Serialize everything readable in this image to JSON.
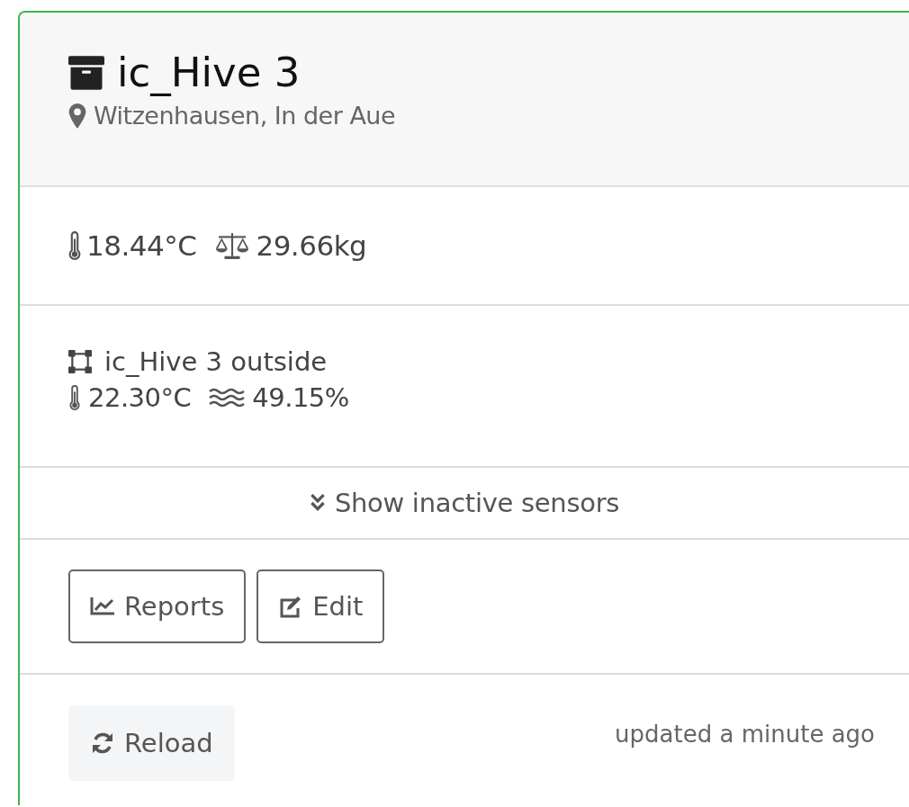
{
  "hive": {
    "title": "ic_Hive 3",
    "location": "Witzenhausen, In der Aue"
  },
  "readings": [
    {
      "kind": "temperature",
      "value": "18.44°C"
    },
    {
      "kind": "weight",
      "value": "29.66kg"
    }
  ],
  "sensor": {
    "name": "ic_Hive 3 outside",
    "readings": [
      {
        "kind": "temperature",
        "value": "22.30°C"
      },
      {
        "kind": "humidity",
        "value": "49.15%"
      }
    ]
  },
  "toggle": "Show inactive sensors",
  "buttons": [
    {
      "kind": "reports",
      "label": "Reports"
    },
    {
      "kind": "edit",
      "label": "Edit"
    }
  ],
  "reload": "Reload",
  "updated": "updated a minute ago"
}
